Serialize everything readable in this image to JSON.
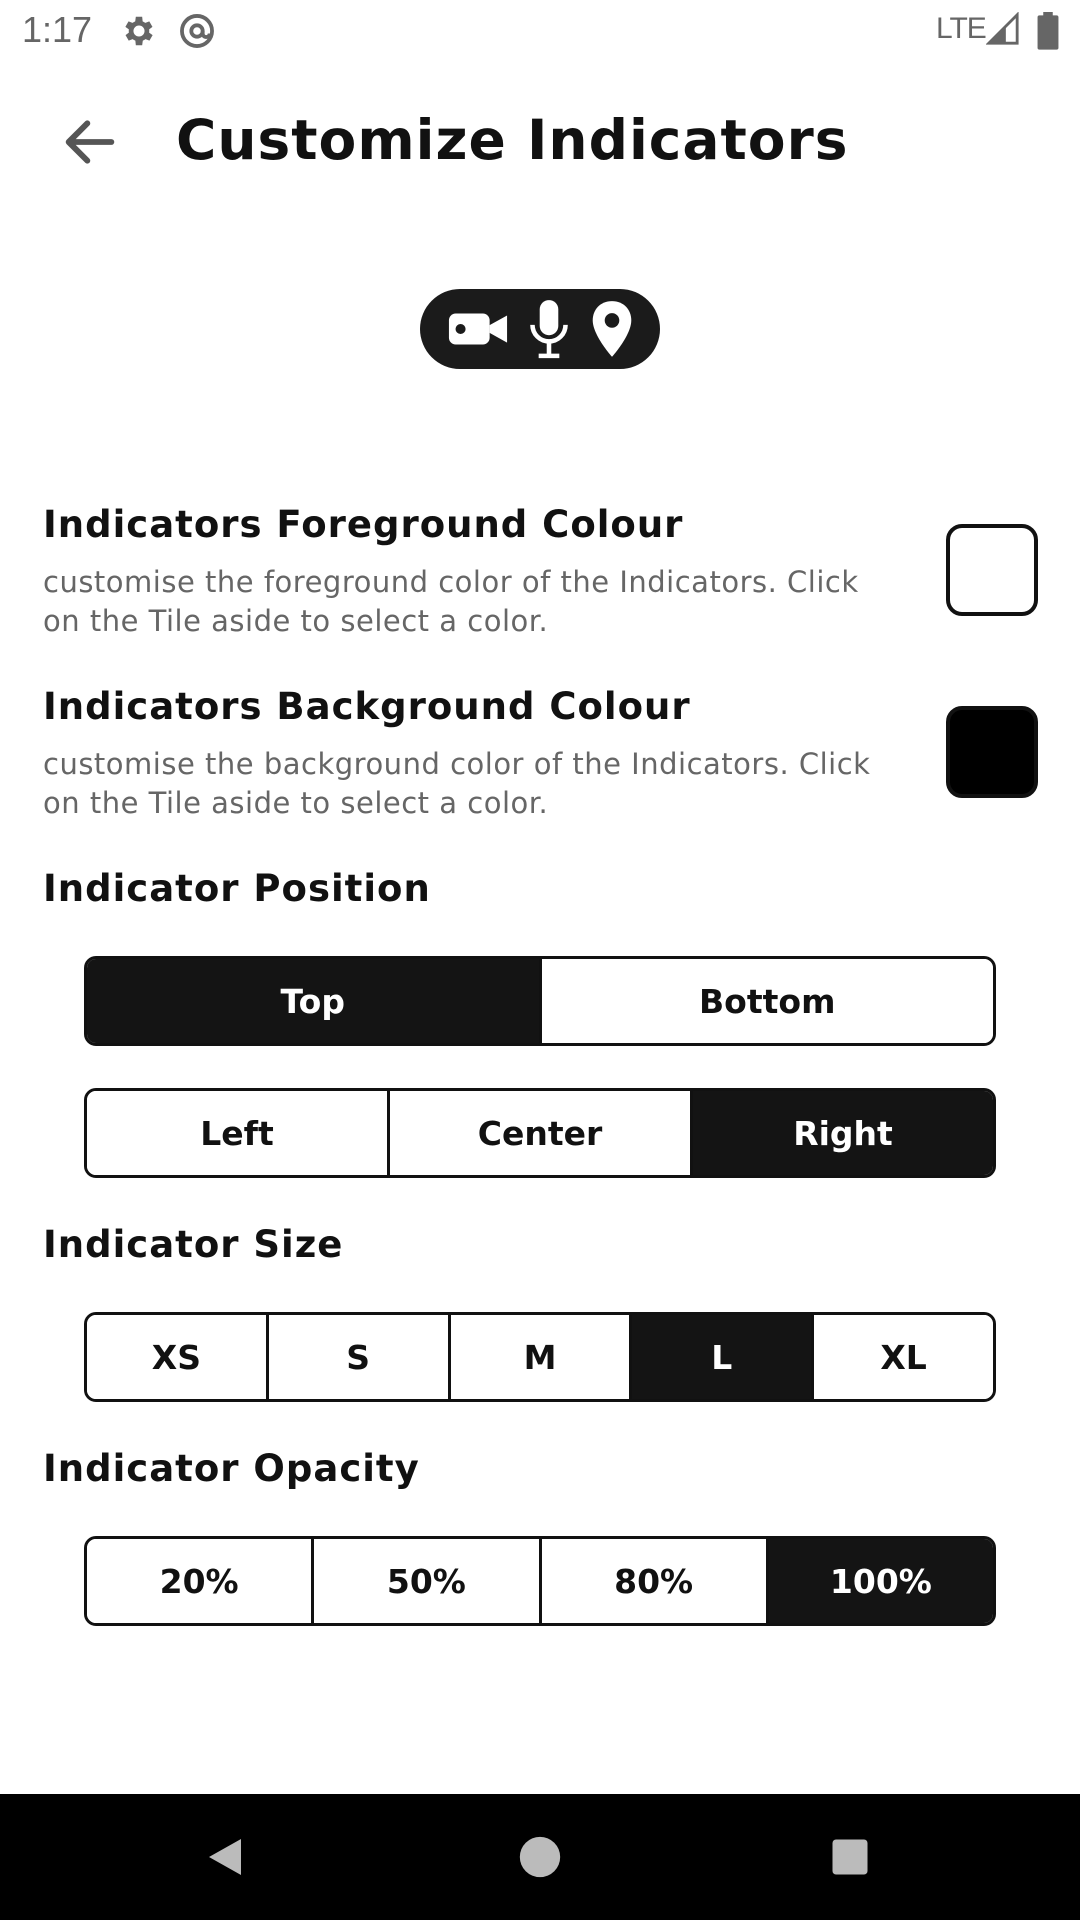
{
  "status_bar": {
    "time": "1:17",
    "network": "LTE",
    "icons": [
      "gear-icon",
      "at-sign-icon",
      "signal-icon",
      "battery-icon"
    ]
  },
  "app_bar": {
    "title": "Customize Indicators",
    "back_icon": "arrow-left-icon"
  },
  "preview": {
    "icons": [
      "video-camera-icon",
      "microphone-icon",
      "location-pin-icon"
    ],
    "foreground_color": "#ffffff",
    "background_color": "#1b1b1b"
  },
  "foreground_setting": {
    "title": "Indicators Foreground Colour",
    "description": "customise the foreground color of the Indicators. Click on the Tile aside to select a color.",
    "tile_color": "#ffffff"
  },
  "background_setting": {
    "title": "Indicators Background Colour",
    "description": "customise the background color of the Indicators. Click on the Tile aside to select a color.",
    "tile_color": "#000000"
  },
  "position": {
    "title": "Indicator Position",
    "vertical_options": [
      "Top",
      "Bottom"
    ],
    "vertical_selected": "Top",
    "horizontal_options": [
      "Left",
      "Center",
      "Right"
    ],
    "horizontal_selected": "Right"
  },
  "size": {
    "title": "Indicator Size",
    "options": [
      "XS",
      "S",
      "M",
      "L",
      "XL"
    ],
    "selected": "L"
  },
  "opacity": {
    "title": "Indicator Opacity",
    "options": [
      "20%",
      "50%",
      "80%",
      "100%"
    ],
    "selected": "100%"
  },
  "nav_bar": {
    "icons": [
      "back-triangle-icon",
      "home-circle-icon",
      "recents-square-icon"
    ]
  },
  "colors": {
    "accent": "#141414",
    "text_primary": "#111111",
    "text_secondary": "#666666"
  }
}
